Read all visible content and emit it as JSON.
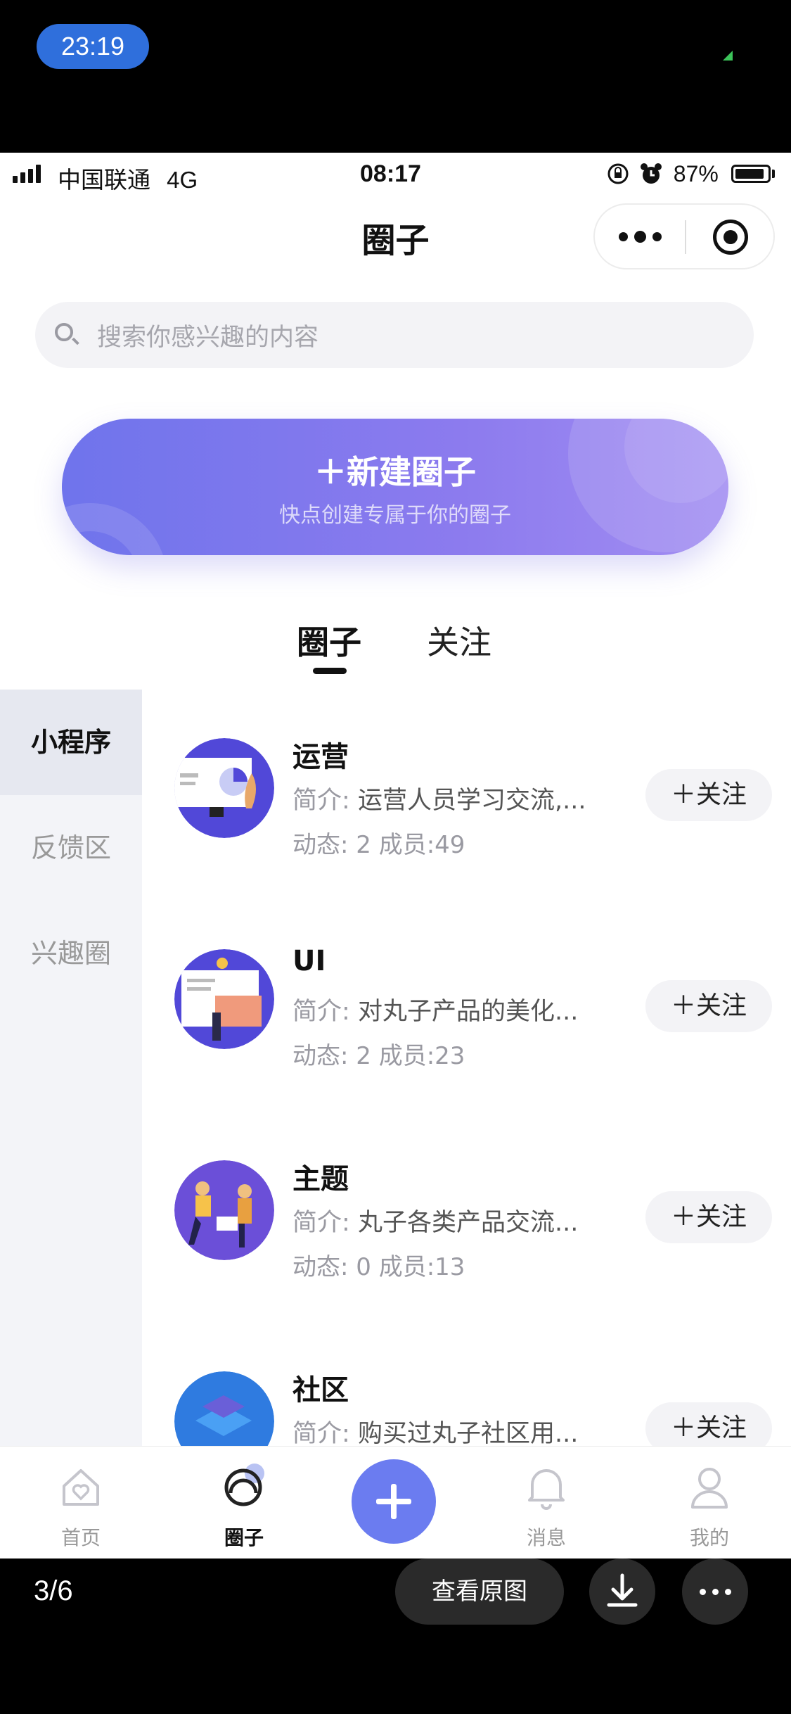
{
  "outer": {
    "time_pill": "23:19",
    "page_indicator": "3/6",
    "view_original_label": "查看原图"
  },
  "status_bar": {
    "carrier": "中国联通",
    "network": "4G",
    "time": "08:17",
    "battery": "87%"
  },
  "header": {
    "title": "圈子"
  },
  "search": {
    "placeholder": "搜索你感兴趣的内容"
  },
  "create": {
    "title": "新建圈子",
    "subtitle": "快点创建专属于你的圈子"
  },
  "tabs": [
    {
      "label": "圈子",
      "active": true
    },
    {
      "label": "关注",
      "active": false
    }
  ],
  "sidebar": {
    "items": [
      {
        "label": "小程序",
        "active": true
      },
      {
        "label": "反馈区",
        "active": false
      },
      {
        "label": "兴趣圈",
        "active": false
      }
    ]
  },
  "circles": [
    {
      "name": "运营",
      "desc_label": "简介:",
      "desc": "运营人员学习交流,...",
      "stats": "动态: 2    成员:49",
      "follow": "关注"
    },
    {
      "name": "UI",
      "desc_label": "简介:",
      "desc": "对丸子产品的美化...",
      "stats": "动态: 2    成员:23",
      "follow": "关注"
    },
    {
      "name": "主题",
      "desc_label": "简介:",
      "desc": "丸子各类产品交流...",
      "stats": "动态: 0    成员:13",
      "follow": "关注"
    },
    {
      "name": "社区",
      "desc_label": "简介:",
      "desc": "购买过丸子社区用...",
      "stats": "",
      "follow": "关注"
    }
  ],
  "tabbar": {
    "items": [
      {
        "label": "首页"
      },
      {
        "label": "圈子",
        "active": true
      },
      {
        "label": "消息"
      },
      {
        "label": "我的"
      }
    ]
  },
  "colors": {
    "accent": "#6b7cf0",
    "banner_start": "#6f74ec",
    "banner_end": "#a28df2"
  }
}
